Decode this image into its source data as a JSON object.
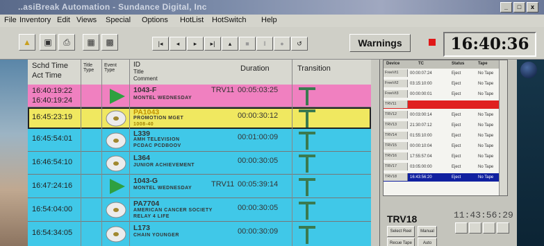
{
  "window": {
    "title": "..asiBreak Automation - Sundance Digital, Inc",
    "controls": [
      "_",
      "□",
      "x"
    ]
  },
  "menu": [
    "File",
    "Inventory",
    "Edit",
    "Views",
    "Special",
    "Options",
    "HotList",
    "HotSwitch",
    "Help"
  ],
  "toolbar": {
    "warnings_label": "Warnings",
    "clock": "16:40:36"
  },
  "grid": {
    "headers": {
      "time1": "Schd Time",
      "time2": "Act Time",
      "title_type": "Title Type",
      "event_type": "Event Type",
      "id_line1": "ID",
      "id_line2": "Title",
      "id_line3": "Comment",
      "duration": "Duration",
      "transition": "Transition"
    },
    "rows": [
      {
        "time": "16:40:19:22",
        "time2": "16:40:19:24",
        "id": "1043-F",
        "title": "MONTEL WEDNESDAY",
        "device": "TRV11",
        "duration": "00:05:03:25",
        "color": "#f080c0",
        "icon": "play"
      },
      {
        "time": "16:45:23:19",
        "time2": "",
        "id": "PA1043",
        "title": "PROMOTION MGET",
        "comment": "1008-40",
        "device": "",
        "duration": "00:00:30:12",
        "color": "#f0e860",
        "icon": "disc"
      },
      {
        "time": "16:45:54:01",
        "time2": "",
        "id": "L339",
        "title": "AMH TELEVISION",
        "comment": "PCDAC PCDBOOV",
        "device": "",
        "duration": "00:01:00:09",
        "color": "#40c8e8",
        "icon": "disc"
      },
      {
        "time": "16:46:54:10",
        "time2": "",
        "id": "L364",
        "title": "JUNIOR ACHIEVEMENT",
        "device": "",
        "duration": "00:00:30:05",
        "color": "#40c8e8",
        "icon": "disc"
      },
      {
        "time": "16:47:24:16",
        "time2": "",
        "id": "1043-G",
        "title": "MONTEL WEDNESDAY",
        "device": "TRV11",
        "duration": "00:05:39:14",
        "color": "#40c8e8",
        "icon": "play"
      },
      {
        "time": "16:54:04:00",
        "time2": "",
        "id": "PA7704",
        "title": "AMERICAN CANCER SOCIETY",
        "comment": "RELAY 4 LIFE",
        "device": "",
        "duration": "00:00:30:05",
        "color": "#40c8e8",
        "icon": "disc"
      },
      {
        "time": "16:54:34:05",
        "time2": "",
        "id": "L173",
        "title": "CHAIN YOUNGER",
        "device": "",
        "duration": "00:00:30:09",
        "color": "#40c8e8",
        "icon": "disc"
      }
    ]
  },
  "devices": {
    "headers": [
      "Device",
      "TC",
      "Status",
      "Tape"
    ],
    "rows": [
      {
        "device": "FreeVt1",
        "tc": "00:00:07:24",
        "status": "Eject",
        "tape": "No Tape",
        "highlight": ""
      },
      {
        "device": "FreeVt2",
        "tc": "03:15:10:00",
        "status": "Eject",
        "tape": "No Tape",
        "highlight": ""
      },
      {
        "device": "FreeVt3",
        "tc": "00:00:00:01",
        "status": "Eject",
        "tape": "No Tape",
        "highlight": ""
      },
      {
        "device": "TRV11",
        "tc": "",
        "status": "",
        "tape": "",
        "highlight": "#e02020"
      },
      {
        "device": "TRV12",
        "tc": "00:03:00:14",
        "status": "Eject",
        "tape": "No Tape",
        "highlight": ""
      },
      {
        "device": "TRV13",
        "tc": "21:30:07:12",
        "status": "Eject",
        "tape": "No Tape",
        "highlight": ""
      },
      {
        "device": "TRV14",
        "tc": "01:55:10:00",
        "status": "Eject",
        "tape": "No Tape",
        "highlight": ""
      },
      {
        "device": "TRV15",
        "tc": "00:00:10:04",
        "status": "Eject",
        "tape": "No Tape",
        "highlight": ""
      },
      {
        "device": "TRV16",
        "tc": "17:55:57:04",
        "status": "Eject",
        "tape": "No Tape",
        "highlight": ""
      },
      {
        "device": "TRV17",
        "tc": "03:05:00:00",
        "status": "Eject",
        "tape": "No Tape",
        "highlight": ""
      },
      {
        "device": "TRV18",
        "tc": "16:43:56:20",
        "status": "Eject",
        "tape": "No Tape",
        "highlight": "#1020a0"
      }
    ],
    "selected": "TRV18",
    "selected_clock": "11:43:56:29",
    "buttons": [
      "Select Reel",
      "Manual",
      "Recue Tape",
      "Auto"
    ]
  }
}
